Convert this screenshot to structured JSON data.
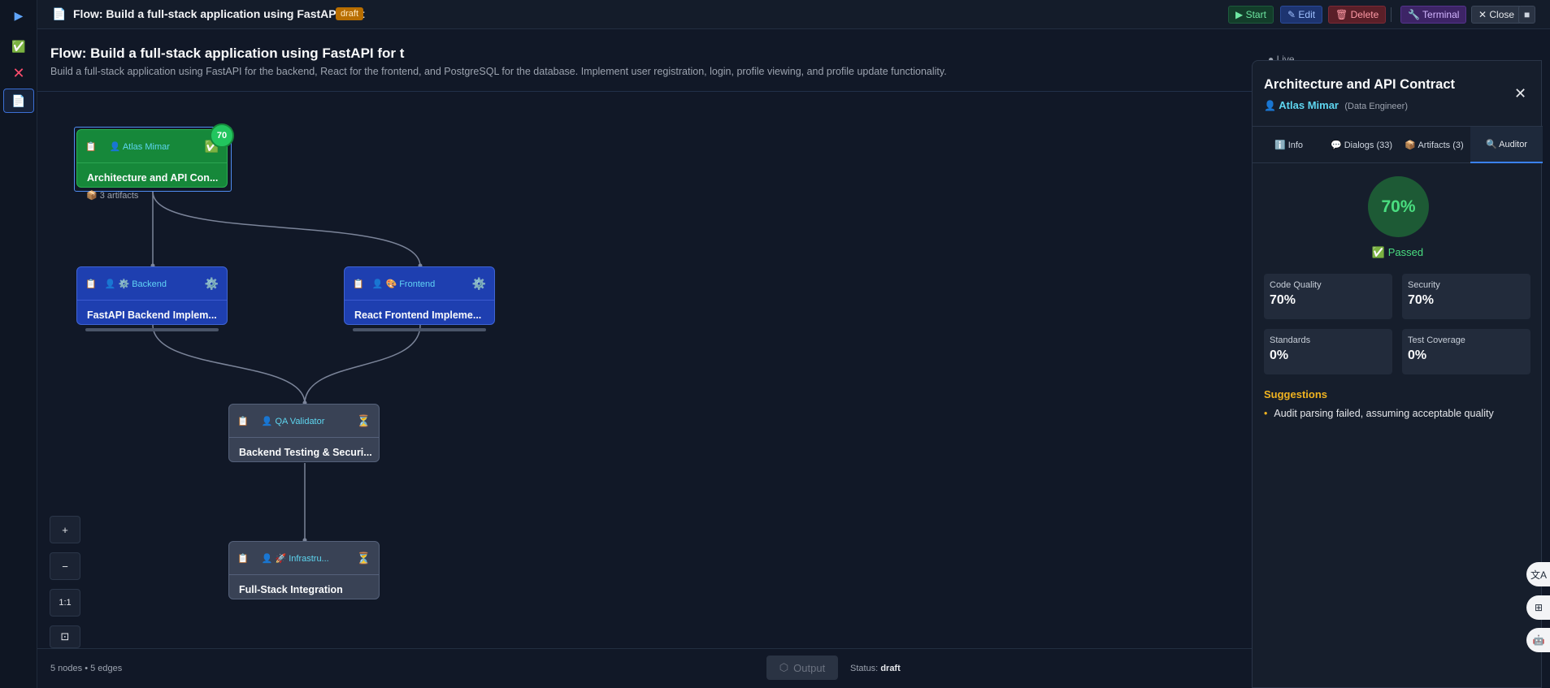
{
  "rail": {
    "items": [
      {
        "icon": "▶",
        "name": "play-icon"
      },
      {
        "icon": "✅",
        "name": "check-icon"
      },
      {
        "icon": "✕",
        "name": "x-icon"
      },
      {
        "icon": "📄",
        "name": "document-icon"
      }
    ]
  },
  "topbar": {
    "icon": "📄",
    "title": "Flow: Build a full-stack application using FastAPI for t",
    "badge": "draft",
    "start": "▶ Start",
    "edit": "✎ Edit",
    "delete": "🗑 Delete",
    "terminal": "🔧 Terminal",
    "close": "✕ Close",
    "extra": "■"
  },
  "flow": {
    "title": "Flow: Build a full-stack application using FastAPI for t",
    "description": "Build a full-stack application using FastAPI for the backend, React for the frontend, and PostgreSQL for the database. Implement user registration, login, profile viewing, and profile update functionality."
  },
  "nodes": {
    "architecture": {
      "doc": "📋",
      "agent": "👤 Atlas Mimar",
      "status": "✅",
      "label": "Architecture and API Con...",
      "score": "70",
      "artifacts": "📦 3 artifacts"
    },
    "backend": {
      "doc": "📋",
      "agent": "👤 ⚙️ Backend",
      "status": "⚙️",
      "label": "FastAPI Backend Implem..."
    },
    "frontend": {
      "doc": "📋",
      "agent": "👤 🎨 Frontend",
      "status": "⚙️",
      "label": "React Frontend Impleme..."
    },
    "qa": {
      "doc": "📋",
      "agent": "👤 QA Validator",
      "status": "⏳",
      "label": "Backend Testing & Securi..."
    },
    "infra": {
      "doc": "📋",
      "agent": "👤 🚀 Infrastru...",
      "status": "⏳",
      "label": "Full-Stack Integration"
    }
  },
  "zoom": {
    "plus": "+",
    "minus": "−",
    "reset": "1:1",
    "fit": "⊡"
  },
  "footer": {
    "stats": "5 nodes • 5 edges",
    "output": "Output",
    "status_label": "Status:",
    "status_value": "draft"
  },
  "live": {
    "text": "● Live"
  },
  "panel": {
    "title": "Architecture and API Contract",
    "close": "✕",
    "user_icon": "👤",
    "user": "Atlas Mimar",
    "role": "(Data Engineer)",
    "tabs": [
      {
        "label": "ℹ️ Info"
      },
      {
        "label": "💬 Dialogs (33)"
      },
      {
        "label": "📦 Artifacts (3)"
      },
      {
        "label": "🔍 Auditor"
      }
    ],
    "score": "70%",
    "passed": "✅ Passed",
    "metrics": [
      {
        "label": "Code Quality",
        "value": "70%"
      },
      {
        "label": "Security",
        "value": "70%"
      },
      {
        "label": "Standards",
        "value": "0%"
      },
      {
        "label": "Test Coverage",
        "value": "0%"
      }
    ],
    "suggestions_title": "Suggestions",
    "suggestions": [
      "Audit parsing failed, assuming acceptable quality"
    ]
  },
  "fabs": [
    "文A",
    "⊞",
    "🤖"
  ],
  "colors": {
    "accent": "#3b82f6",
    "success": "#22c55e",
    "warning": "#f0b320",
    "danger": "#ef4444"
  }
}
